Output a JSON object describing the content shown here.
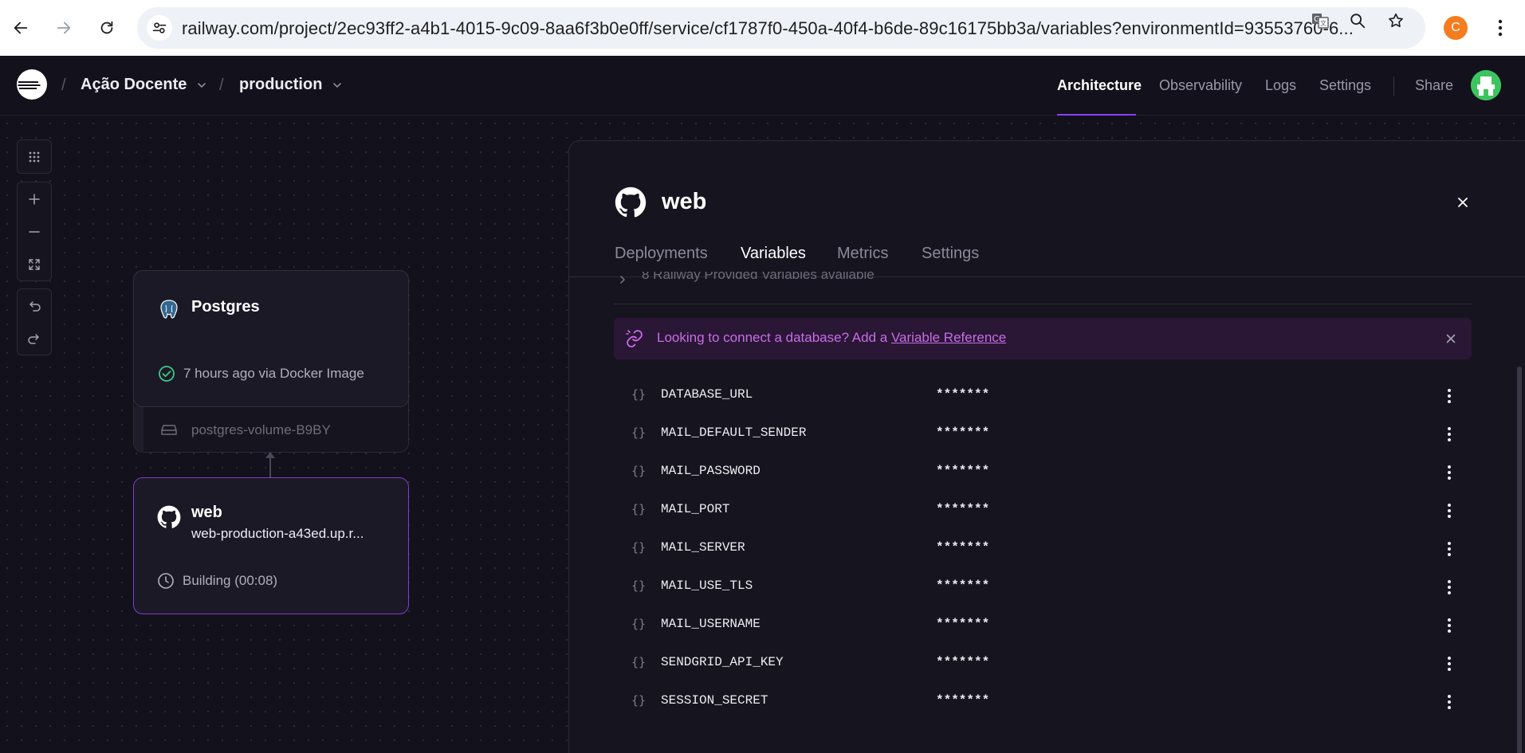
{
  "browser": {
    "url": "railway.com/project/2ec93ff2-a4b1-4015-9c09-8aa6f3b0e0ff/service/cf1787f0-450a-40f4-b6de-89c16175bb3a/variables?environmentId=93553760-6...",
    "profile_initial": "C",
    "icons": [
      "back-icon",
      "forward-icon",
      "reload-icon",
      "site-settings-icon",
      "translate-icon",
      "zoom-icon",
      "star-icon",
      "kebab-menu-icon"
    ]
  },
  "header": {
    "project_name": "Ação Docente",
    "environment": "production",
    "nav": [
      "Architecture",
      "Observability",
      "Logs",
      "Settings"
    ],
    "active_nav": "Architecture",
    "share_label": "Share",
    "accent_color": "#8a3ffc"
  },
  "canvas": {
    "tools": [
      "grid-icon",
      "zoom-in-icon",
      "zoom-out-icon",
      "fit-view-icon",
      "undo-icon",
      "redo-icon"
    ],
    "postgres": {
      "title": "Postgres",
      "status": "7 hours ago via Docker Image",
      "volume": "postgres-volume-B9BY"
    },
    "web": {
      "title": "web",
      "domain": "web-production-a43ed.up.r...",
      "status": "Building (00:08)"
    }
  },
  "panel": {
    "title": "web",
    "tabs": [
      "Deployments",
      "Variables",
      "Metrics",
      "Settings"
    ],
    "active_tab": "Variables",
    "provided_vars": "8 Railway Provided Variables available",
    "banner": {
      "text": "Looking to connect a database? Add a",
      "link": "Variable Reference",
      "color": "#c86de6"
    },
    "variables": [
      {
        "brace": "{}",
        "name": "DATABASE_URL",
        "value": "*******"
      },
      {
        "brace": "{}",
        "name": "MAIL_DEFAULT_SENDER",
        "value": "*******"
      },
      {
        "brace": "{}",
        "name": "MAIL_PASSWORD",
        "value": "*******"
      },
      {
        "brace": "{}",
        "name": "MAIL_PORT",
        "value": "*******"
      },
      {
        "brace": "{}",
        "name": "MAIL_SERVER",
        "value": "*******"
      },
      {
        "brace": "{}",
        "name": "MAIL_USE_TLS",
        "value": "*******"
      },
      {
        "brace": "{}",
        "name": "MAIL_USERNAME",
        "value": "*******"
      },
      {
        "brace": "{}",
        "name": "SENDGRID_API_KEY",
        "value": "*******"
      },
      {
        "brace": "{}",
        "name": "SESSION_SECRET",
        "value": "*******"
      }
    ]
  }
}
